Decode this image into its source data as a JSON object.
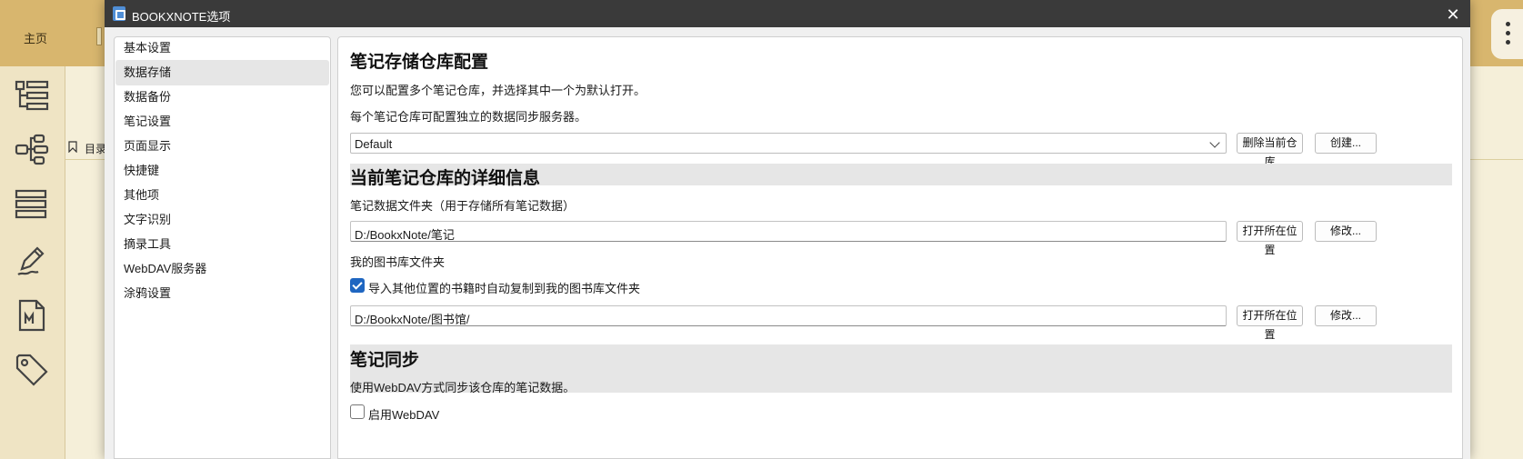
{
  "app": {
    "home_tab": "主页",
    "toc_label": "目录"
  },
  "dialog": {
    "title": "BOOKXNOTE选项",
    "close_symbol": "✕"
  },
  "nav": {
    "items": [
      {
        "label": "基本设置",
        "active": false
      },
      {
        "label": "数据存储",
        "active": true
      },
      {
        "label": "数据备份",
        "active": false
      },
      {
        "label": "笔记设置",
        "active": false
      },
      {
        "label": "页面显示",
        "active": false
      },
      {
        "label": "快捷键",
        "active": false
      },
      {
        "label": "其他项",
        "active": false
      },
      {
        "label": "文字识别",
        "active": false
      },
      {
        "label": "摘录工具",
        "active": false
      },
      {
        "label": "WebDAV服务器",
        "active": false
      },
      {
        "label": "涂鸦设置",
        "active": false
      }
    ]
  },
  "storage": {
    "title": "笔记存储仓库配置",
    "desc1": "您可以配置多个笔记仓库，并选择其中一个为默认打开。",
    "desc2": "每个笔记仓库可配置独立的数据同步服务器。",
    "repo_selected": "Default",
    "delete_label": "删除当前仓库",
    "create_label": "创建..."
  },
  "details": {
    "title": "当前笔记仓库的详细信息",
    "notes_folder_label": "笔记数据文件夹（用于存储所有笔记数据）",
    "notes_folder_path": "D:/BookxNote/笔记",
    "open_location_label": "打开所在位置",
    "modify_label": "修改...",
    "library_folder_label": "我的图书库文件夹",
    "auto_copy_label": "导入其他位置的书籍时自动复制到我的图书库文件夹",
    "auto_copy_checked": true,
    "library_folder_path": "D:/BookxNote/图书馆/"
  },
  "sync": {
    "title": "笔记同步",
    "desc": "使用WebDAV方式同步该仓库的笔记数据。",
    "enable_label": "启用WebDAV",
    "enable_checked": false
  },
  "colors": {
    "topbar": "#d8b66e",
    "accent": "#1f66c1",
    "titlebar": "#3a3a3a"
  }
}
